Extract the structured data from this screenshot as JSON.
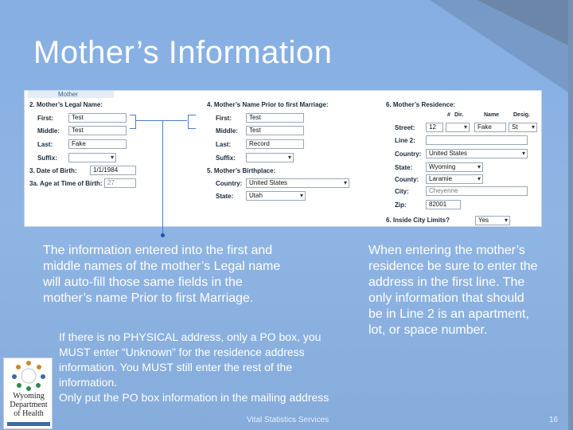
{
  "slide": {
    "title": "Mother’s Information",
    "footer": "Vital Statistics Services",
    "page_number": "16"
  },
  "form": {
    "tab": "Mother",
    "section2": "2. Mother’s Legal Name:",
    "first_label": "First:",
    "first_value": "Test",
    "middle_label": "Middle:",
    "middle_value": "Test",
    "last_label": "Last:",
    "last_value": "Fake",
    "suffix_label": "Suffix:",
    "dob_label": "3. Date of Birth:",
    "dob_value": "1/1/1984",
    "age_label": "3a. Age at Time of Birth:",
    "age_value": "27",
    "section4": "4. Mother’s Name Prior to first Marriage:",
    "p_first_label": "First:",
    "p_first_value": "Test",
    "p_middle_label": "Middle:",
    "p_middle_value": "Test",
    "p_last_label": "Last:",
    "p_last_value": "Record",
    "p_suffix_label": "Suffix:",
    "section5": "5. Mother’s Birthplace:",
    "country_label": "Country:",
    "country_value": "United States",
    "state_label": "State:",
    "state_value": "Utah",
    "section6": "6. Mother’s Residence:",
    "col_num": "#",
    "col_dir": "Dir.",
    "col_name": "Name",
    "col_desig": "Desig.",
    "street_label": "Street:",
    "street_num": "12",
    "street_name": "Fake",
    "street_desig": "St",
    "line2_label": "Line 2:",
    "r_country_label": "Country:",
    "r_country_value": "United States",
    "r_state_label": "State:",
    "r_state_value": "Wyoming",
    "county_label": "County:",
    "county_value": "Laramie",
    "city_label": "City:",
    "city_value": "Cheyenne",
    "zip_label": "Zip:",
    "zip_value": "82001",
    "city_limits_label": "6. Inside City Limits?",
    "city_limits_value": "Yes"
  },
  "notes": {
    "left_main": "The information entered into the first and middle names of the mother’s Legal name will auto-fill those same fields in the mother’s name Prior to first Marriage.",
    "left_sub1": "If there is no PHYSICAL address, only a PO box, you MUST enter “Unknown” for the residence address information. You MUST still enter the rest of the information.",
    "left_sub2": "Only put the PO box information in the mailing address",
    "right": "When entering the mother’s residence be sure to enter the address in the first line. The only information that should be in Line 2 is an apartment, lot, or space number."
  },
  "logo": {
    "line1": "Wyoming",
    "line2": "Department",
    "line3": "of Health"
  },
  "colors": {
    "background": "#8eb2e0",
    "accent_line": "#4a7ec2"
  }
}
